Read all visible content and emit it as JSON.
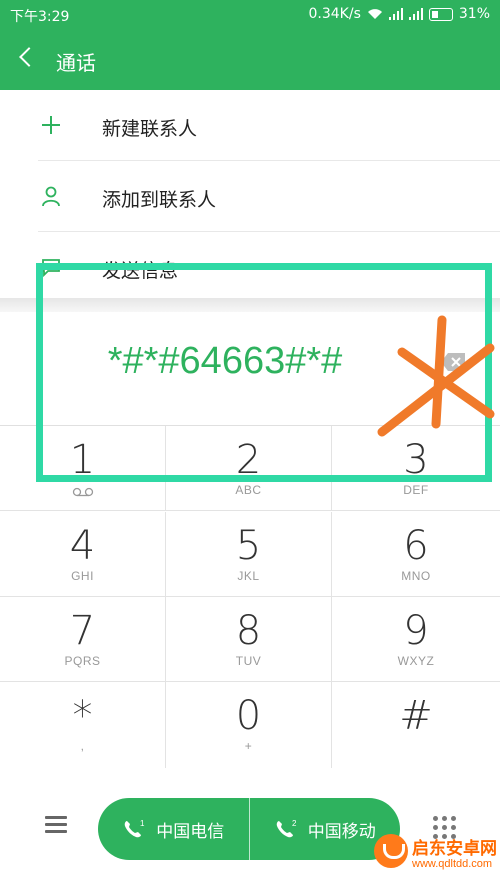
{
  "status_bar": {
    "time": "下午3:29",
    "speed": "0.34K/s",
    "battery": "31%"
  },
  "header": {
    "title": "通话"
  },
  "menu": {
    "items": [
      {
        "label": "新建联系人",
        "icon": "plus-icon"
      },
      {
        "label": "添加到联系人",
        "icon": "person-icon"
      },
      {
        "label": "发送信息",
        "icon": "message-icon"
      }
    ]
  },
  "dialer": {
    "number": "*#*#64663#*#"
  },
  "keypad": {
    "keys": [
      {
        "digit": "1",
        "letters": ""
      },
      {
        "digit": "2",
        "letters": "ABC"
      },
      {
        "digit": "3",
        "letters": "DEF"
      },
      {
        "digit": "4",
        "letters": "GHI"
      },
      {
        "digit": "5",
        "letters": "JKL"
      },
      {
        "digit": "6",
        "letters": "MNO"
      },
      {
        "digit": "7",
        "letters": "PQRS"
      },
      {
        "digit": "8",
        "letters": "TUV"
      },
      {
        "digit": "9",
        "letters": "WXYZ"
      },
      {
        "digit": "*",
        "letters": ","
      },
      {
        "digit": "0",
        "letters": "+"
      },
      {
        "digit": "#",
        "letters": ""
      }
    ]
  },
  "call_buttons": {
    "sim1": {
      "sim": "1",
      "label": "中国电信"
    },
    "sim2": {
      "sim": "2",
      "label": "中国移动"
    }
  },
  "watermark": {
    "name": "启东安卓网",
    "url": "www.qdltdd.com"
  },
  "colors": {
    "brand_green": "#2eb25e",
    "highlight": "#2fd9a5",
    "annotation_orange": "#f07a2a"
  }
}
